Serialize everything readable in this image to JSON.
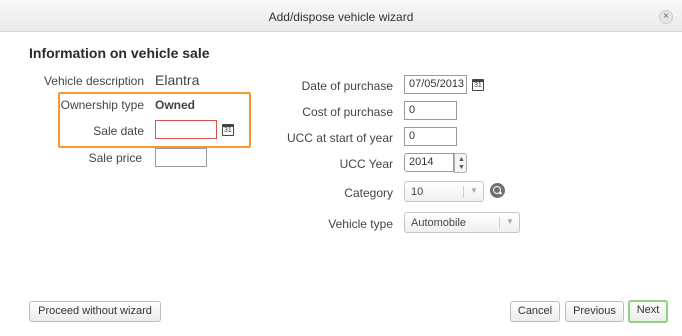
{
  "dialog": {
    "title": "Add/dispose vehicle wizard",
    "close_glyph": "×"
  },
  "section": {
    "heading": "Information on vehicle sale"
  },
  "left": {
    "vehicle_description_label": "Vehicle description",
    "vehicle_description_value": "Elantra",
    "ownership_type_label": "Ownership type",
    "ownership_type_value": "Owned",
    "sale_date_label": "Sale date",
    "sale_date_value": "",
    "sale_price_label": "Sale price",
    "sale_price_value": ""
  },
  "right": {
    "date_of_purchase_label": "Date of purchase",
    "date_of_purchase_value": "07/05/2013",
    "cost_of_purchase_label": "Cost of purchase",
    "cost_of_purchase_value": "0",
    "ucc_start_label": "UCC at start of year",
    "ucc_start_value": "0",
    "ucc_year_label": "UCC Year",
    "ucc_year_value": "2014",
    "category_label": "Category",
    "category_value": "10",
    "vehicle_type_label": "Vehicle type",
    "vehicle_type_value": "Automobile"
  },
  "footer": {
    "proceed_label": "Proceed without wizard",
    "cancel_label": "Cancel",
    "previous_label": "Previous",
    "next_label": "Next"
  },
  "colors": {
    "highlight": "#f39a2b",
    "invalid_border": "#d9534f",
    "primary_border": "#8fd37f"
  }
}
